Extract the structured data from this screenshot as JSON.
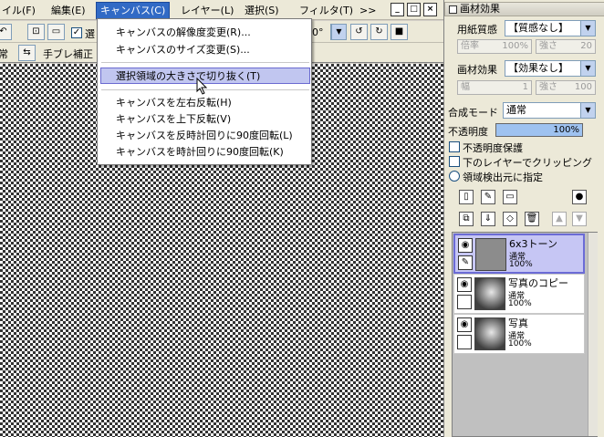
{
  "menubar": {
    "items": [
      "イル(F)",
      "編集(E)",
      "キャンバス(C)",
      "レイヤー(L)",
      "選択(S)",
      "フィルタ(T)",
      ">>"
    ],
    "window_buttons": [
      "_",
      "□",
      "×"
    ]
  },
  "toolbar": {
    "checkbox_label": "選",
    "angle_value": "0°",
    "mode_label": "常",
    "stabilizer_label": "手ブレ補正"
  },
  "canvas_menu": {
    "items": [
      "キャンバスの解像度変更(R)...",
      "キャンバスのサイズ変更(S)...",
      "選択領域の大きさで切り抜く(T)",
      "キャンバスを左右反転(H)",
      "キャンバスを上下反転(V)",
      "キャンバスを反時計回りに90度回転(L)",
      "キャンバスを時計回りに90度回転(K)"
    ],
    "highlighted_index": 2
  },
  "panel": {
    "title": "画材効果",
    "paper_texture_label": "用紙質感",
    "paper_texture_value": "【質感なし】",
    "magnification_label": "倍率",
    "magnification_value": "100%",
    "strength_label": "強さ",
    "strength_value_1": "20",
    "material_effect_label": "画材効果",
    "material_effect_value": "【効果なし】",
    "width_label": "幅",
    "width_value": "1",
    "strength_value_2": "100",
    "blend_mode_label": "合成モード",
    "blend_mode_value": "通常",
    "opacity_label": "不透明度",
    "opacity_value": "100%",
    "protect_opacity_label": "不透明度保護",
    "clipping_label": "下のレイヤーでクリッピング",
    "region_source_label": "領域検出元に指定"
  },
  "layers": [
    {
      "name": "6x3トーン",
      "mode": "通常",
      "opacity": "100%",
      "selected": true
    },
    {
      "name": "写真のコピー",
      "mode": "通常",
      "opacity": "100%",
      "selected": false
    },
    {
      "name": "写真",
      "mode": "通常",
      "opacity": "100%",
      "selected": false
    }
  ],
  "colors": {
    "menu_highlight": "#c1c6f0",
    "selected_layer": "#c6c6f4",
    "opacity_bar": "#9ec2f0"
  }
}
